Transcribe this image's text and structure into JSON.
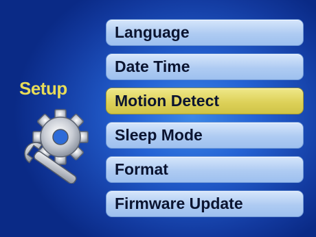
{
  "side_title": "Setup",
  "icon": "gear-wrench-icon",
  "menu": {
    "items": [
      {
        "label": "Language"
      },
      {
        "label": "Date Time"
      },
      {
        "label": "Motion Detect"
      },
      {
        "label": "Sleep Mode"
      },
      {
        "label": "Format"
      },
      {
        "label": "Firmware Update"
      }
    ],
    "selected_index": 2
  },
  "colors": {
    "background": "#2563d4",
    "item_bg": "#aecbf2",
    "item_selected_bg": "#ddd159",
    "title_color": "#e8dc58"
  }
}
